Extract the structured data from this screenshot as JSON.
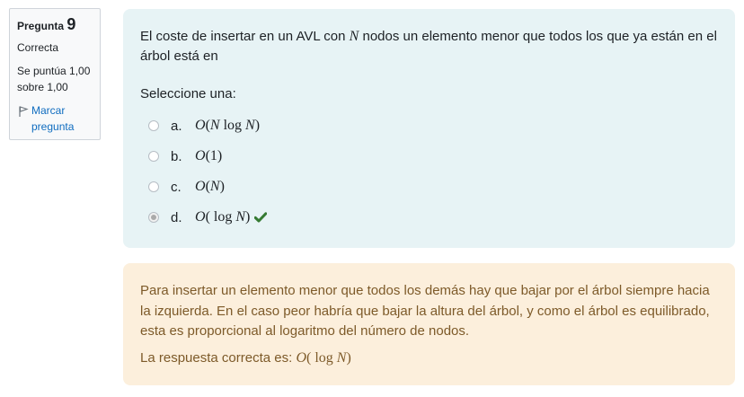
{
  "info": {
    "question_label": "Pregunta",
    "question_number": "9",
    "state": "Correcta",
    "grade": "Se puntúa 1,00 sobre 1,00",
    "flag_label": "Marcar pregunta"
  },
  "question": {
    "text_before": "El coste de insertar en un AVL con ",
    "variable": "N",
    "text_after": " nodos un elemento menor que todos los que ya están en el árbol está en",
    "prompt": "Seleccione una:",
    "options": [
      {
        "letter": "a.",
        "formula": "O(N log N)",
        "selected": false
      },
      {
        "letter": "b.",
        "formula": "O(1)",
        "selected": false
      },
      {
        "letter": "c.",
        "formula": "O(N)",
        "selected": false
      },
      {
        "letter": "d.",
        "formula": "O( log N)",
        "selected": true
      }
    ]
  },
  "feedback": {
    "explanation": "Para insertar un elemento menor que todos los demás hay que bajar por el árbol siempre hacia la izquierda. En el caso peor habría que bajar la altura del árbol, y como el árbol es equilibrado, esta es proporcional al logaritmo del número de nodos.",
    "right_answer_label": "La respuesta correcta es: ",
    "right_answer": "O( log N)"
  },
  "colors": {
    "question_bg": "#e7f3f5",
    "feedback_bg": "#fcefdc",
    "feedback_text": "#7d5a29",
    "correct": "#357a32",
    "link": "#0f6cbf"
  },
  "icons": {
    "flag": "flag-icon",
    "correct": "check-icon"
  }
}
